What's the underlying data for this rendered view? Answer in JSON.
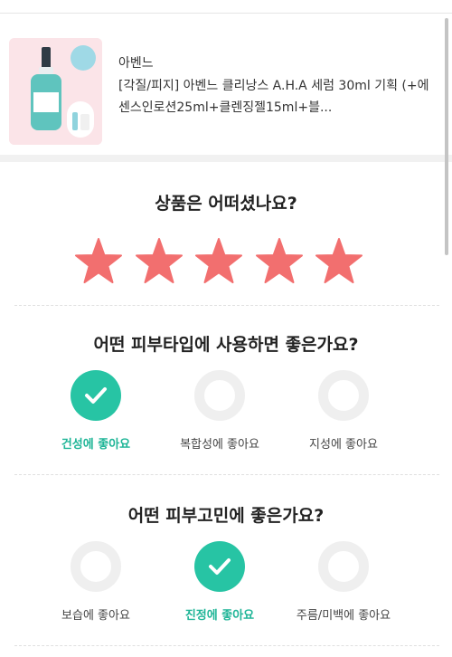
{
  "product": {
    "brand": "아벤느",
    "name": "[각질/피지] 아벤느 클리낭스 A.H.A 세럼 30ml 기획 (+에센스인로션25ml+클렌징젤15ml+블..."
  },
  "rating": {
    "question": "상품은 어떠셨나요?",
    "stars": 5,
    "max": 5,
    "star_color": "#f26f6f"
  },
  "skin_type": {
    "question": "어떤 피부타입에 사용하면 좋은가요?",
    "options": [
      {
        "label": "건성에 좋아요",
        "selected": true
      },
      {
        "label": "복합성에 좋아요",
        "selected": false
      },
      {
        "label": "지성에 좋아요",
        "selected": false
      }
    ]
  },
  "skin_concern": {
    "question": "어떤 피부고민에 좋은가요?",
    "options": [
      {
        "label": "보습에 좋아요",
        "selected": false
      },
      {
        "label": "진정에 좋아요",
        "selected": true
      },
      {
        "label": "주름/미백에 좋아요",
        "selected": false
      }
    ]
  },
  "colors": {
    "accent": "#27c4a4",
    "star": "#f26f6f",
    "unselected_ring": "#efefef"
  }
}
